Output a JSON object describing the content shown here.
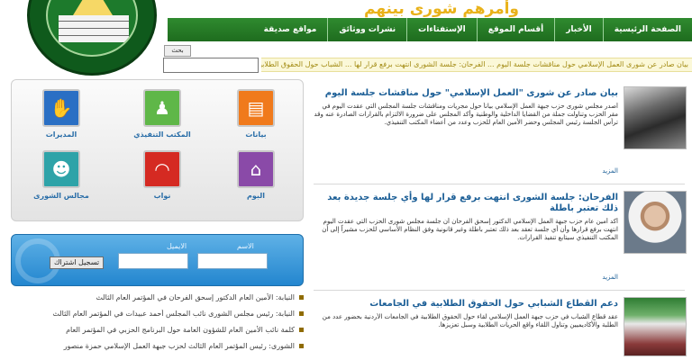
{
  "header": {
    "slogan": "وأمرهم شورى بينهم",
    "nav": [
      "الصفحة الرئيسية",
      "الأخبار",
      "أقسام الموقع",
      "الإستفتاءات",
      "نشرات ووثائق",
      "مواقع صديقة"
    ]
  },
  "search": {
    "button_label": "بحث"
  },
  "ticker": {
    "text": "بيان صادر عن شورى العمل الإسلامي حول مناقشات جلسة اليوم ... الفرحان: جلسة الشورى انتهت برفع قرار لها ... الشباب حول الحقوق الطلابية"
  },
  "tiles": [
    {
      "label": "بيانات",
      "icon": "document-icon",
      "color": "#f07a1c"
    },
    {
      "label": "المكتب التنفيذي",
      "icon": "meeting-icon",
      "color": "#5fb748"
    },
    {
      "label": "المديرات",
      "icon": "handshake-icon",
      "color": "#2a6fc4"
    },
    {
      "label": "البوم",
      "icon": "home-icon",
      "color": "#8a4aa8"
    },
    {
      "label": "نواب",
      "icon": "signal-icon",
      "color": "#d52a22"
    },
    {
      "label": "مجالس الشورى",
      "icon": "people-icon",
      "color": "#2ea3a8"
    }
  ],
  "member": {
    "name_label": "الاسم",
    "password_label": "الايميل",
    "register_button": "تسجيل اشتراك"
  },
  "news_list": [
    "النيابة: الأمين العام الدكتور إسحق الفرحان في المؤتمر العام الثالث",
    "النيابة: رئيس مجلس الشورى نائب المجلس أحمد عبيدات في المؤتمر العام الثالث",
    "كلمة نائب الأمين العام للشؤون العامة حول البرنامج الحزبي في المؤتمر العام",
    "الشورى: رئيس المؤتمر العام الثالث لحزب جبهة العمل الإسلامي حمزة منصور"
  ],
  "articles": [
    {
      "title": "بيان صادر عن شورى \"العمل الإسلامي\" حول مناقشات جلسة اليوم",
      "body": "أصدر مجلس شورى حزب جبهة العمل الإسلامي بياناً حول مجريات ومناقشات جلسة المجلس التي عقدت اليوم في مقر الحزب وتناولت جملة من القضايا الداخلية والوطنية وأكد المجلس على ضرورة الالتزام بالقرارات الصادرة عنه وقد ترأس الجلسة رئيس المجلس وحضر الأمين العام للحزب وعدد من أعضاء المكتب التنفيذي.",
      "more": "المزيد"
    },
    {
      "title": "الفرحان: جلسة الشورى انتهت برفع قرار لها وأي جلسة جديدة بعد ذلك تعتبر باطلة",
      "body": "أكد أمين عام حزب جبهة العمل الإسلامي الدكتور إسحق الفرحان أن جلسة مجلس شورى الحزب التي عقدت اليوم انتهت برفع قرارها وأن أي جلسة تعقد بعد ذلك تعتبر باطلة وغير قانونية وفق النظام الأساسي للحزب مشيراً إلى أن المكتب التنفيذي سيتابع تنفيذ القرارات.",
      "more": "المزيد"
    },
    {
      "title": "دعم القطاع الشبابي حول الحقوق الطلابية في الجامعات",
      "body": "عقد قطاع الشباب في حزب جبهة العمل الإسلامي لقاء حول الحقوق الطلابية في الجامعات الأردنية بحضور عدد من الطلبة والأكاديميين وتناول اللقاء واقع الحريات الطلابية وسبل تعزيزها.",
      "more": "المزيد"
    }
  ]
}
